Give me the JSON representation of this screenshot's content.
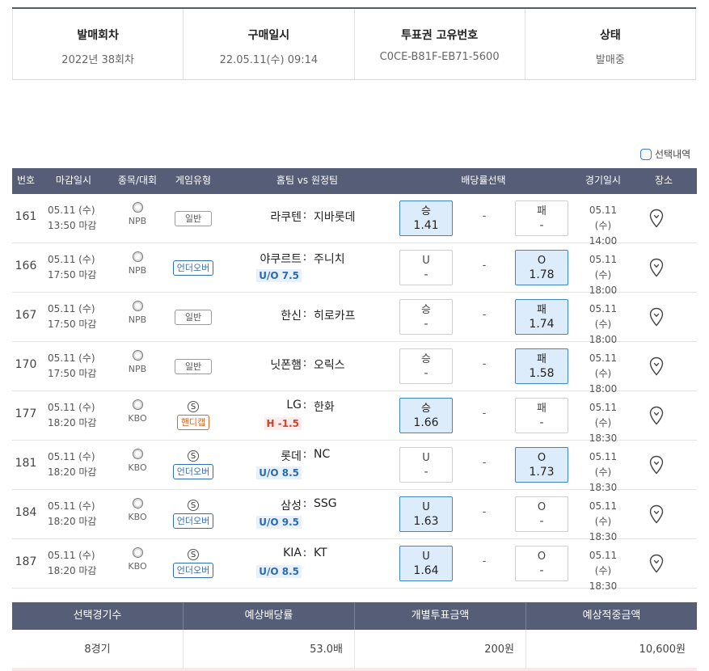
{
  "info": {
    "items": [
      {
        "label": "발매회차",
        "value": "2022년 38회차"
      },
      {
        "label": "구매일시",
        "value": "22.05.11(수) 09:14"
      },
      {
        "label": "투표권 고유번호",
        "value": "C0CE-B81F-EB71-5600"
      },
      {
        "label": "상태",
        "value": "발매중"
      }
    ]
  },
  "selection_toggle": {
    "label": "선택내역"
  },
  "table": {
    "headers": {
      "no": "번호",
      "deadline": "마감일시",
      "sport": "종목/대회",
      "type": "게임유형",
      "match": "홈팀 vs 원정팀",
      "odds": "배당률선택",
      "time": "경기일시",
      "place": "장소"
    },
    "rows": [
      {
        "no": "161",
        "dl_date": "05.11 (수)",
        "dl_time": "13:50 마감",
        "league": "NPB",
        "special": "",
        "type": "일반",
        "type_kind": "nm",
        "home": "라쿠텐",
        "colon": ":",
        "away": "지바롯데",
        "sub": "",
        "sub_kind": "",
        "left_top": "승",
        "left_bottom": "1.41",
        "left_sel": true,
        "draw": "-",
        "right_top": "패",
        "right_bottom": "-",
        "right_sel": false,
        "g_date": "05.11 (수)",
        "g_time": "14:00"
      },
      {
        "no": "166",
        "dl_date": "05.11 (수)",
        "dl_time": "17:50 마감",
        "league": "NPB",
        "special": "",
        "type": "언더오버",
        "type_kind": "uo",
        "home": "야쿠르트",
        "colon": ":",
        "away": "주니치",
        "sub": "U/O 7.5",
        "sub_kind": "uo",
        "left_top": "U",
        "left_bottom": "-",
        "left_sel": false,
        "draw": "-",
        "right_top": "O",
        "right_bottom": "1.78",
        "right_sel": true,
        "g_date": "05.11 (수)",
        "g_time": "18:00"
      },
      {
        "no": "167",
        "dl_date": "05.11 (수)",
        "dl_time": "17:50 마감",
        "league": "NPB",
        "special": "",
        "type": "일반",
        "type_kind": "nm",
        "home": "한신",
        "colon": ":",
        "away": "히로카프",
        "sub": "",
        "sub_kind": "",
        "left_top": "승",
        "left_bottom": "-",
        "left_sel": false,
        "draw": "-",
        "right_top": "패",
        "right_bottom": "1.74",
        "right_sel": true,
        "g_date": "05.11 (수)",
        "g_time": "18:00"
      },
      {
        "no": "170",
        "dl_date": "05.11 (수)",
        "dl_time": "17:50 마감",
        "league": "NPB",
        "special": "",
        "type": "일반",
        "type_kind": "nm",
        "home": "닛폰햄",
        "colon": ":",
        "away": "오릭스",
        "sub": "",
        "sub_kind": "",
        "left_top": "승",
        "left_bottom": "-",
        "left_sel": false,
        "draw": "-",
        "right_top": "패",
        "right_bottom": "1.58",
        "right_sel": true,
        "g_date": "05.11 (수)",
        "g_time": "18:00"
      },
      {
        "no": "177",
        "dl_date": "05.11 (수)",
        "dl_time": "18:20 마감",
        "league": "KBO",
        "special": "S",
        "type": "핸디캡",
        "type_kind": "hc",
        "home": "LG",
        "colon": ":",
        "away": "한화",
        "sub": "H -1.5",
        "sub_kind": "hc",
        "left_top": "승",
        "left_bottom": "1.66",
        "left_sel": true,
        "draw": "-",
        "right_top": "패",
        "right_bottom": "-",
        "right_sel": false,
        "g_date": "05.11 (수)",
        "g_time": "18:30"
      },
      {
        "no": "181",
        "dl_date": "05.11 (수)",
        "dl_time": "18:20 마감",
        "league": "KBO",
        "special": "S",
        "type": "언더오버",
        "type_kind": "uo",
        "home": "롯데",
        "colon": ":",
        "away": "NC",
        "sub": "U/O 8.5",
        "sub_kind": "uo",
        "left_top": "U",
        "left_bottom": "-",
        "left_sel": false,
        "draw": "-",
        "right_top": "O",
        "right_bottom": "1.73",
        "right_sel": true,
        "g_date": "05.11 (수)",
        "g_time": "18:30"
      },
      {
        "no": "184",
        "dl_date": "05.11 (수)",
        "dl_time": "18:20 마감",
        "league": "KBO",
        "special": "S",
        "type": "언더오버",
        "type_kind": "uo",
        "home": "삼성",
        "colon": ":",
        "away": "SSG",
        "sub": "U/O 9.5",
        "sub_kind": "uo",
        "left_top": "U",
        "left_bottom": "1.63",
        "left_sel": true,
        "draw": "-",
        "right_top": "O",
        "right_bottom": "-",
        "right_sel": false,
        "g_date": "05.11 (수)",
        "g_time": "18:30"
      },
      {
        "no": "187",
        "dl_date": "05.11 (수)",
        "dl_time": "18:20 마감",
        "league": "KBO",
        "special": "S",
        "type": "언더오버",
        "type_kind": "uo",
        "home": "KIA",
        "colon": ":",
        "away": "KT",
        "sub": "U/O 8.5",
        "sub_kind": "uo",
        "left_top": "U",
        "left_bottom": "1.64",
        "left_sel": true,
        "draw": "-",
        "right_top": "O",
        "right_bottom": "-",
        "right_sel": false,
        "g_date": "05.11 (수)",
        "g_time": "18:30"
      }
    ]
  },
  "summary": {
    "headers": [
      "선택경기수",
      "예상배당률",
      "개별투표금액",
      "예상적중금액"
    ],
    "values": [
      "8경기",
      "53.0배",
      "200원",
      "10,600원"
    ]
  },
  "colors": {
    "header_bg": "#565d77",
    "selected_bg": "#dcecfa",
    "selected_border": "#3f86c6",
    "uo_blue": "#2f6db5",
    "handicap_orange": "#d66a2a"
  },
  "icons": {
    "sport": "baseball-icon",
    "place": "map-pin-icon"
  }
}
